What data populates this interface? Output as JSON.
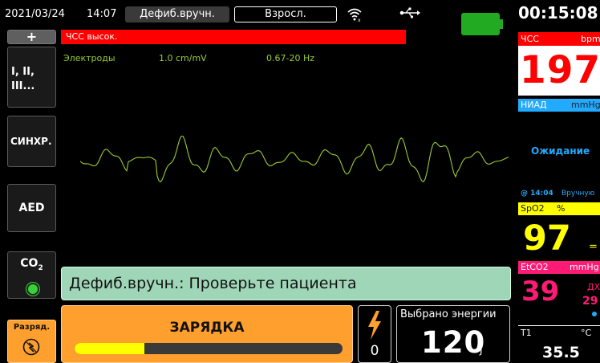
{
  "status_bar": {
    "date": "2021/03/24",
    "time": "14:07",
    "mode": "Дефиб.вручн.",
    "patient_type": "Взросл.",
    "elapsed": "00:15:08"
  },
  "left_panel": {
    "add_label": "+",
    "leads_label": "I, II,\nIII...",
    "sync_label": "СИНХР.",
    "aed_label": "AED",
    "co2_label": "CO",
    "co2_sub": "2",
    "discharge_label": "Разряд."
  },
  "alarm": {
    "text": "ЧСС высок."
  },
  "ecg": {
    "lead": "Электроды",
    "gain": "1.0 cm/mV",
    "filter": "0.67-20 Hz"
  },
  "message": "Дефиб.вручн.: Проверьте пациента",
  "charge": {
    "label": "ЗАРЯДКА",
    "progress": 0.26
  },
  "shock": {
    "count": "0"
  },
  "energy": {
    "title": "Выбрано энергии",
    "value": "120",
    "unit": "J"
  },
  "vitals": {
    "hr": {
      "label": "ЧСС",
      "unit": "bpm",
      "value": "197"
    },
    "nibp": {
      "label": "НИАД",
      "unit": "mmHg",
      "status": "Ожидание",
      "last_time": "@ 14:04",
      "mode": "Вручную"
    },
    "spo2": {
      "label": "SpO2",
      "unit": "%",
      "value": "97",
      "trend": "="
    },
    "etco2": {
      "label": "EtCO2",
      "unit": "mmHg",
      "value": "39",
      "resp_label": "ДХ",
      "resp_value": "29"
    },
    "temp": {
      "label": "T1",
      "unit": "°C",
      "value": "35.5"
    }
  },
  "colors": {
    "hr": "#ff0000",
    "nibp": "#22aaff",
    "spo2": "#ffff00",
    "etco2": "#ff1a75",
    "ecg_trace": "#9acd32",
    "battery": "#22aa22"
  }
}
